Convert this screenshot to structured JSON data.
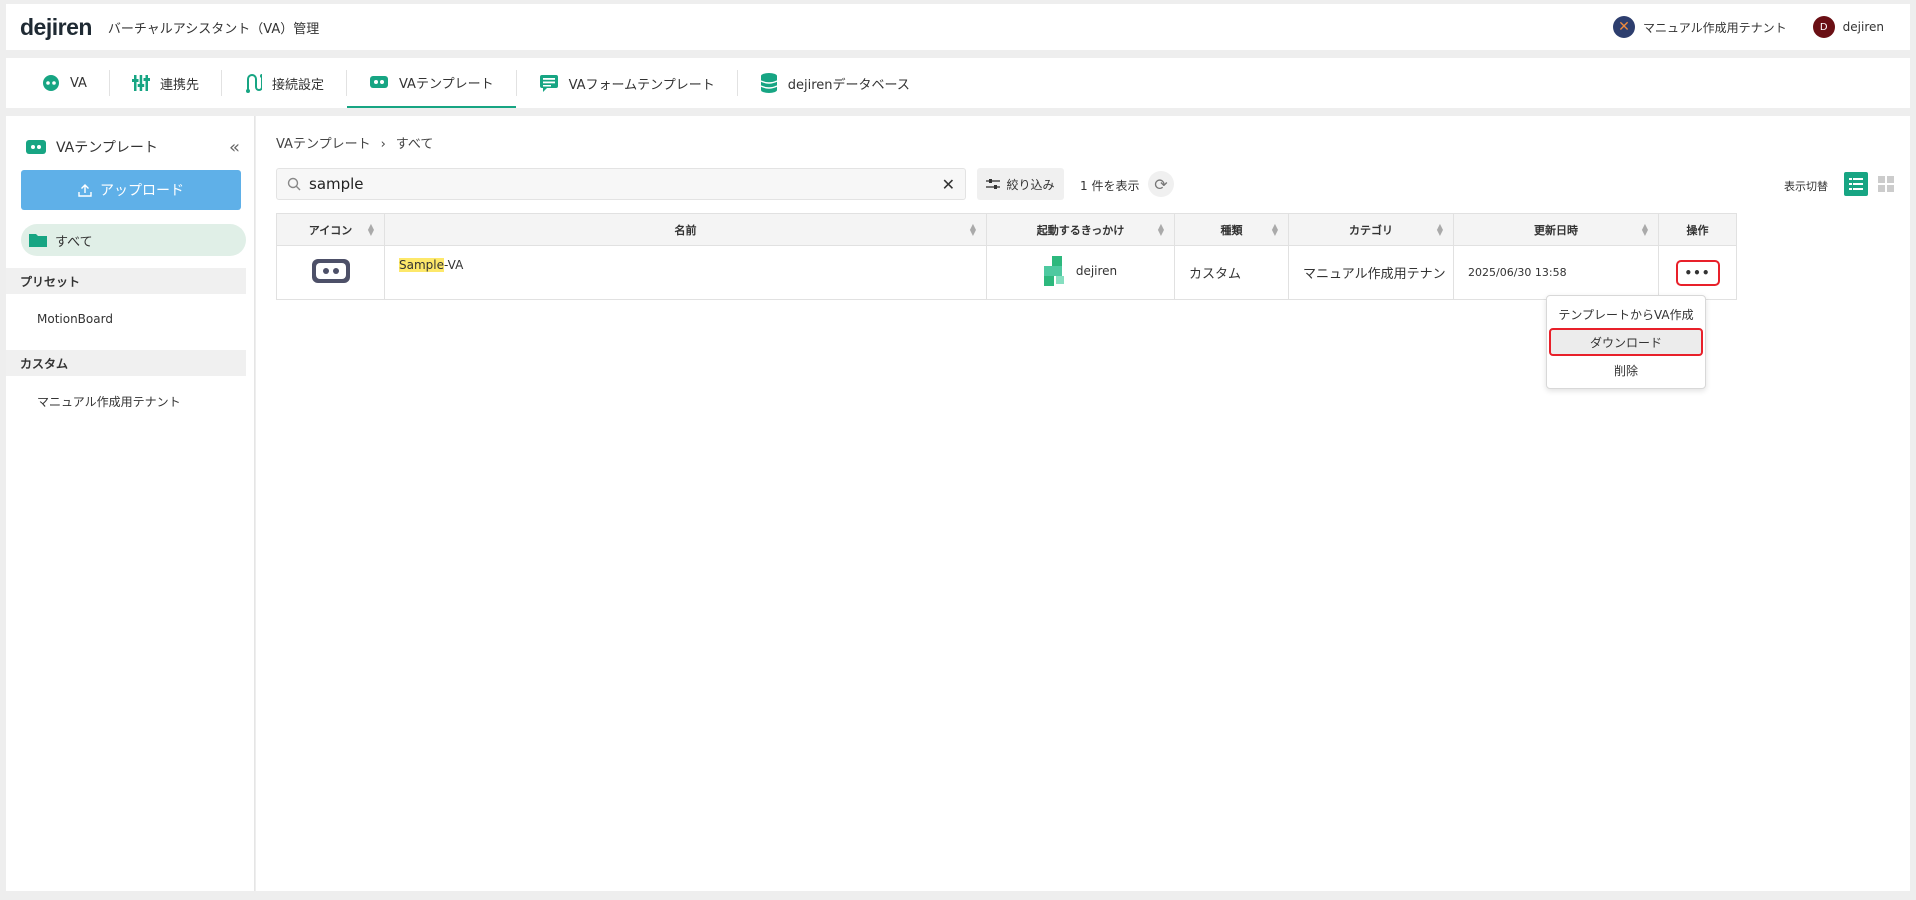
{
  "header": {
    "logo": "dejiren",
    "title": "バーチャルアシスタント（VA）管理",
    "tenant": "マニュアル作成用テナント",
    "user_initial": "D",
    "user": "dejiren"
  },
  "tabs": [
    {
      "label": "VA",
      "icon": "robot-face-icon"
    },
    {
      "label": "連携先",
      "icon": "sliders-icon"
    },
    {
      "label": "接続設定",
      "icon": "connection-icon"
    },
    {
      "label": "VAテンプレート",
      "icon": "template-icon",
      "active": true
    },
    {
      "label": "VAフォームテンプレート",
      "icon": "form-icon"
    },
    {
      "label": "dejirenデータベース",
      "icon": "database-icon"
    }
  ],
  "sidebar": {
    "title": "VAテンプレート",
    "upload_label": "アップロード",
    "all_label": "すべて",
    "sections": [
      {
        "label": "プリセット",
        "items": [
          "MotionBoard"
        ]
      },
      {
        "label": "カスタム",
        "items": [
          "マニュアル作成用テナント"
        ]
      }
    ]
  },
  "breadcrumb": {
    "root": "VAテンプレート",
    "sep": "›",
    "current": "すべて"
  },
  "search": {
    "value": "sample",
    "clear_glyph": "✕"
  },
  "filter_label": "絞り込み",
  "count_text": "1 件を表示",
  "view_toggle_label": "表示切替",
  "table": {
    "columns": [
      "アイコン",
      "名前",
      "起動するきっかけ",
      "種類",
      "カテゴリ",
      "更新日時",
      "操作"
    ],
    "rows": [
      {
        "name_highlight": "Sample",
        "name_rest": "-VA",
        "trigger": "dejiren",
        "type": "カスタム",
        "category": "マニュアル作成用テナン",
        "updated": "2025/06/30 13:58",
        "ops": "•••"
      }
    ]
  },
  "menu": {
    "items": [
      "テンプレートからVA作成",
      "ダウンロード",
      "削除"
    ],
    "selected_index": 1
  },
  "colors": {
    "accent": "#17a583",
    "upload": "#5fb0e8",
    "highlight_border": "#e8202a"
  }
}
